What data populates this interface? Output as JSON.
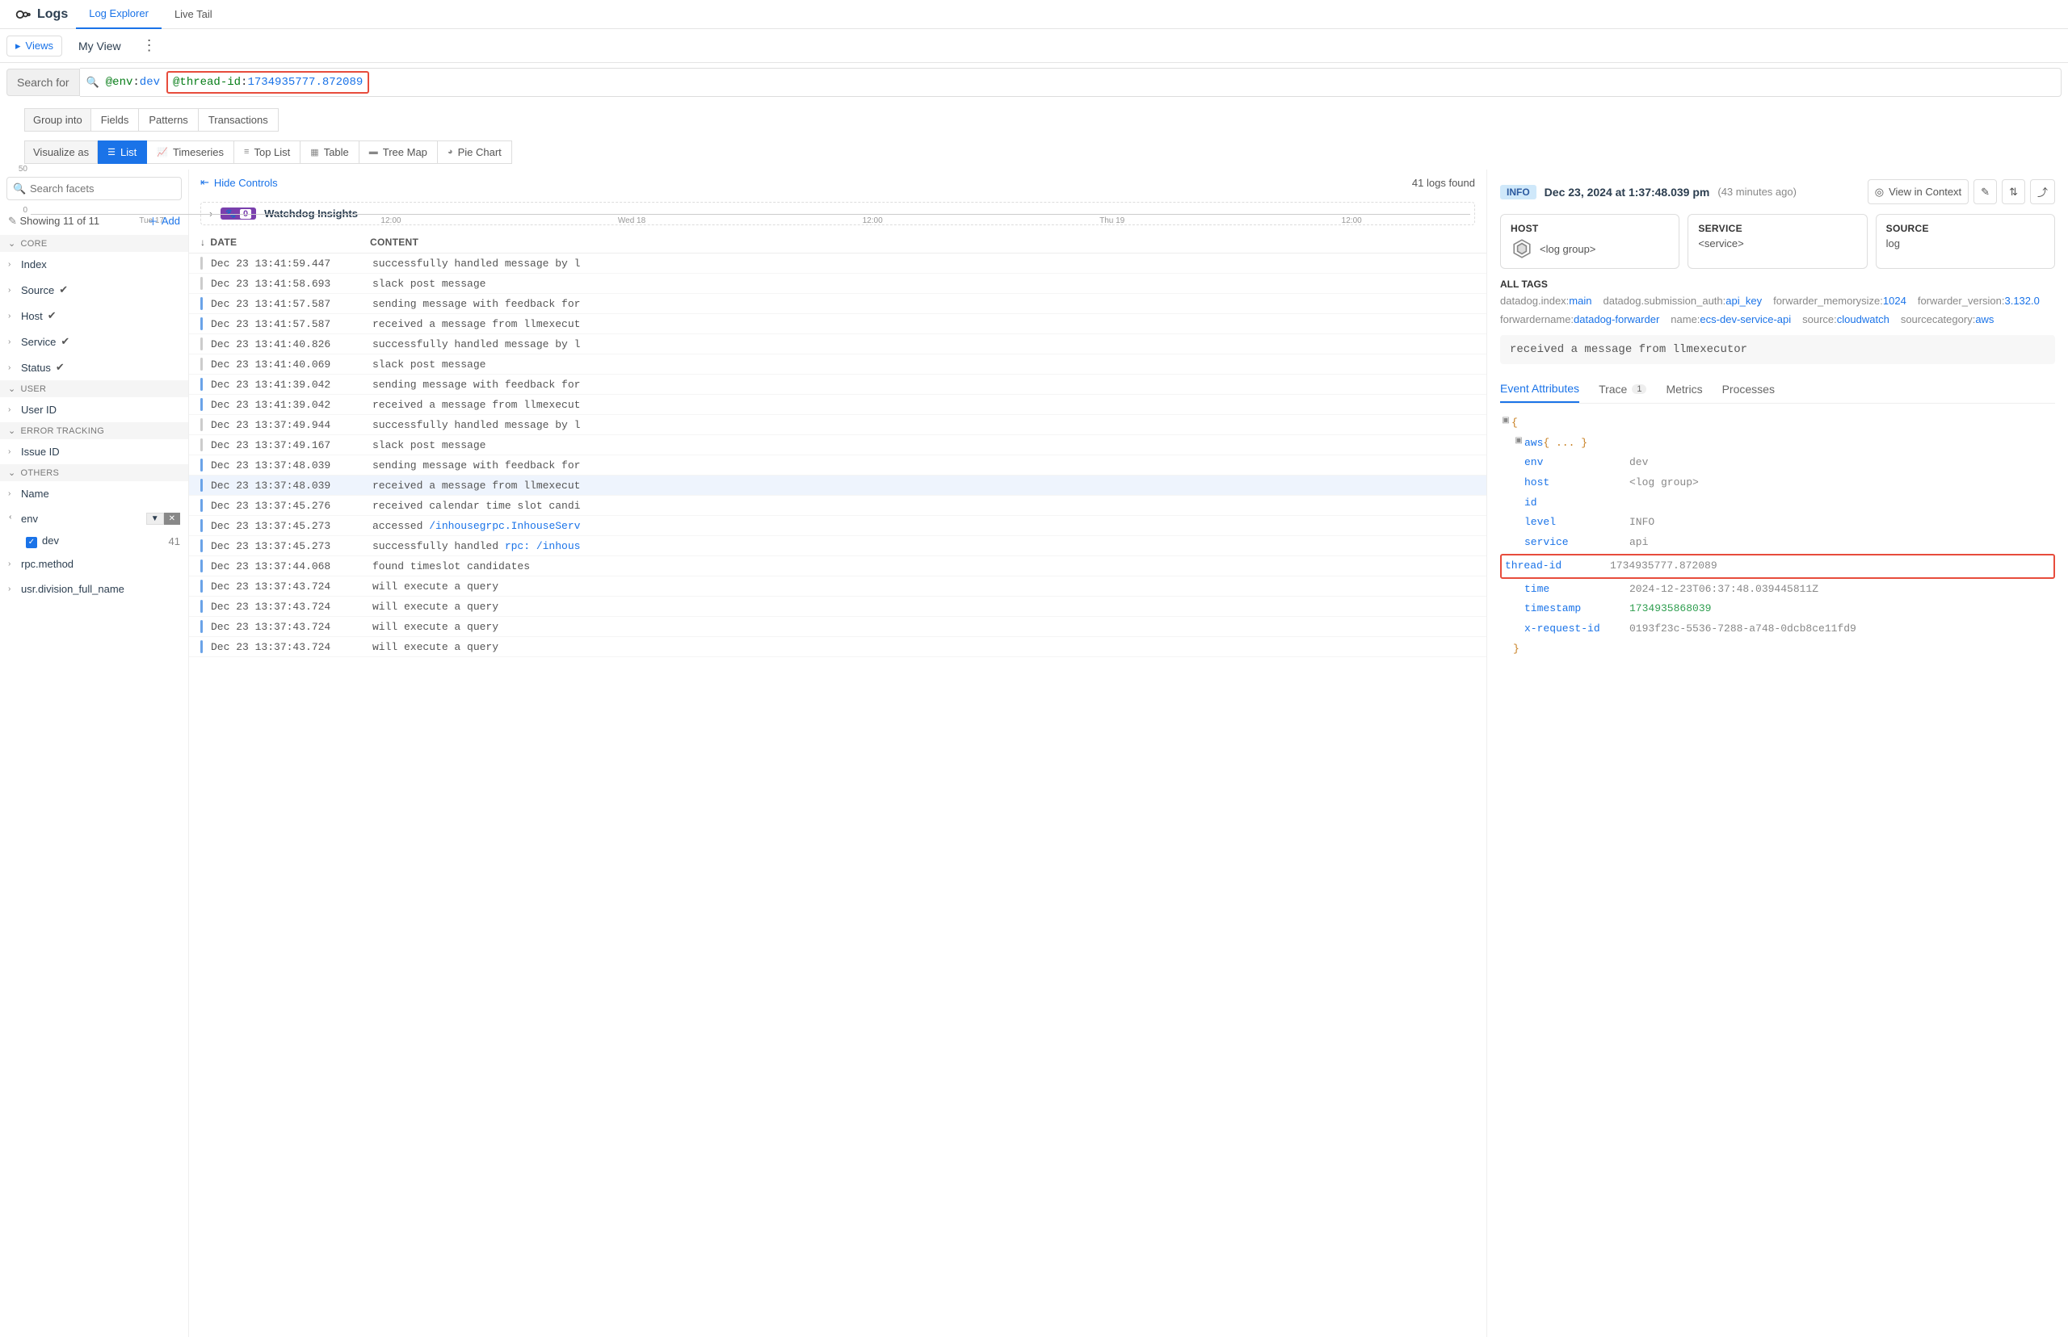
{
  "chart_data": {
    "type": "bar",
    "title": "",
    "xlabel": "",
    "ylabel": "",
    "ylim": [
      0,
      50
    ],
    "yticks": [
      0,
      50
    ],
    "xticks": [
      "Tue 17",
      "12:00",
      "Wed 18",
      "12:00",
      "Thu 19",
      "12:00"
    ],
    "series": [
      {
        "name": "logs",
        "note": "no visible bars; empty histogram over time range",
        "values": []
      }
    ]
  },
  "brand": "Logs",
  "top_tabs": {
    "explorer": "Log Explorer",
    "live_tail": "Live Tail"
  },
  "views_btn": "Views",
  "my_view": "My View",
  "search": {
    "label": "Search for",
    "token1_key": "@env",
    "token1_val": "dev",
    "token2_key": "@thread-id",
    "token2_val": "1734935777.872089"
  },
  "group_row": {
    "label": "Group into",
    "fields": "Fields",
    "patterns": "Patterns",
    "transactions": "Transactions"
  },
  "viz_row": {
    "label": "Visualize as",
    "list": "List",
    "timeseries": "Timeseries",
    "top_list": "Top List",
    "table": "Table",
    "tree_map": "Tree Map",
    "pie_chart": "Pie Chart"
  },
  "facets": {
    "search_placeholder": "Search facets",
    "showing": "Showing 11 of 11",
    "add": "Add",
    "groups": {
      "core": "CORE",
      "user": "USER",
      "error": "ERROR TRACKING",
      "others": "OTHERS"
    },
    "items": {
      "index": "Index",
      "source": "Source",
      "host": "Host",
      "service": "Service",
      "status": "Status",
      "user_id": "User ID",
      "issue_id": "Issue ID",
      "name": "Name",
      "env": "env",
      "rpc_method": "rpc.method",
      "usr_division": "usr.division_full_name"
    },
    "env_value": {
      "label": "dev",
      "count": "41"
    }
  },
  "logs_header": {
    "hide_controls": "Hide Controls",
    "found": "41 logs found",
    "watchdog": "Watchdog Insights",
    "watchdog_count": "0",
    "col_date": "DATE",
    "col_content": "CONTENT"
  },
  "log_rows": [
    {
      "sev": "gray",
      "date": "Dec 23 13:41:59.447",
      "content": "successfully handled message by l"
    },
    {
      "sev": "gray",
      "date": "Dec 23 13:41:58.693",
      "content": "slack post message"
    },
    {
      "sev": "info",
      "date": "Dec 23 13:41:57.587",
      "content": "sending message with feedback for"
    },
    {
      "sev": "info",
      "date": "Dec 23 13:41:57.587",
      "content": "received a message from llmexecut"
    },
    {
      "sev": "gray",
      "date": "Dec 23 13:41:40.826",
      "content": "successfully handled message by l"
    },
    {
      "sev": "gray",
      "date": "Dec 23 13:41:40.069",
      "content": "slack post message"
    },
    {
      "sev": "info",
      "date": "Dec 23 13:41:39.042",
      "content": "sending message with feedback for"
    },
    {
      "sev": "info",
      "date": "Dec 23 13:41:39.042",
      "content": "received a message from llmexecut"
    },
    {
      "sev": "gray",
      "date": "Dec 23 13:37:49.944",
      "content": "successfully handled message by l"
    },
    {
      "sev": "gray",
      "date": "Dec 23 13:37:49.167",
      "content": "slack post message"
    },
    {
      "sev": "info",
      "date": "Dec 23 13:37:48.039",
      "content": "sending message with feedback for"
    },
    {
      "sev": "info",
      "date": "Dec 23 13:37:48.039",
      "content": "received a message from llmexecut",
      "selected": true
    },
    {
      "sev": "info",
      "date": "Dec 23 13:37:45.276",
      "content": "received calendar time slot candi"
    },
    {
      "sev": "info",
      "date": "Dec 23 13:37:45.273",
      "content_html": "accessed <span class='link'>/inhousegrpc.InhouseServ</span>"
    },
    {
      "sev": "info",
      "date": "Dec 23 13:37:45.273",
      "content_html": "successfully handled <span class='link'>rpc: /inhous</span>"
    },
    {
      "sev": "info",
      "date": "Dec 23 13:37:44.068",
      "content": "found timeslot candidates"
    },
    {
      "sev": "info",
      "date": "Dec 23 13:37:43.724",
      "content": "will execute a query"
    },
    {
      "sev": "info",
      "date": "Dec 23 13:37:43.724",
      "content": "will execute a query"
    },
    {
      "sev": "info",
      "date": "Dec 23 13:37:43.724",
      "content": "will execute a query"
    },
    {
      "sev": "info",
      "date": "Dec 23 13:37:43.724",
      "content": "will execute a query"
    }
  ],
  "detail": {
    "level": "INFO",
    "timestamp": "Dec 23, 2024 at 1:37:48.039 pm",
    "relative": "(43 minutes ago)",
    "view_in_context": "View in Context",
    "cards": {
      "host": {
        "label": "HOST",
        "value": "<log group>"
      },
      "service": {
        "label": "SERVICE",
        "value": "<service>"
      },
      "source": {
        "label": "SOURCE",
        "value": "log"
      }
    },
    "all_tags_label": "ALL TAGS",
    "tags": [
      {
        "k": "datadog.index:",
        "v": "main"
      },
      {
        "k": "datadog.submission_auth:",
        "v": "api_key"
      },
      {
        "k": "forwarder_memorysize:",
        "v": "1024"
      },
      {
        "k": "forwarder_version:",
        "v": "3.132.0"
      },
      {
        "k": "forwardername:",
        "v": "datadog-forwarder"
      },
      {
        "k": "name:",
        "v": "ecs-dev-service-api"
      },
      {
        "k": "source:",
        "v": "cloudwatch"
      },
      {
        "k": "sourcecategory:",
        "v": "aws"
      }
    ],
    "message": "received a message from llmexecutor",
    "tabs": {
      "event_attrs": "Event Attributes",
      "trace": "Trace",
      "trace_count": "1",
      "metrics": "Metrics",
      "processes": "Processes"
    },
    "json": {
      "aws_label": "aws",
      "aws_val": "{ ... }",
      "rows": [
        {
          "key": "env",
          "val": "dev"
        },
        {
          "key": "host",
          "val": "<log group>"
        },
        {
          "key": "id",
          "val": ""
        },
        {
          "key": "level",
          "val": "INFO"
        },
        {
          "key": "service",
          "val": "api"
        },
        {
          "key": "thread-id",
          "val": "1734935777.872089",
          "highlight": true
        },
        {
          "key": "time",
          "val": "2024-12-23T06:37:48.039445811Z"
        },
        {
          "key": "timestamp",
          "val": "1734935868039",
          "green": true
        },
        {
          "key": "x-request-id",
          "val": "0193f23c-5536-7288-a748-0dcb8ce11fd9"
        }
      ]
    }
  }
}
